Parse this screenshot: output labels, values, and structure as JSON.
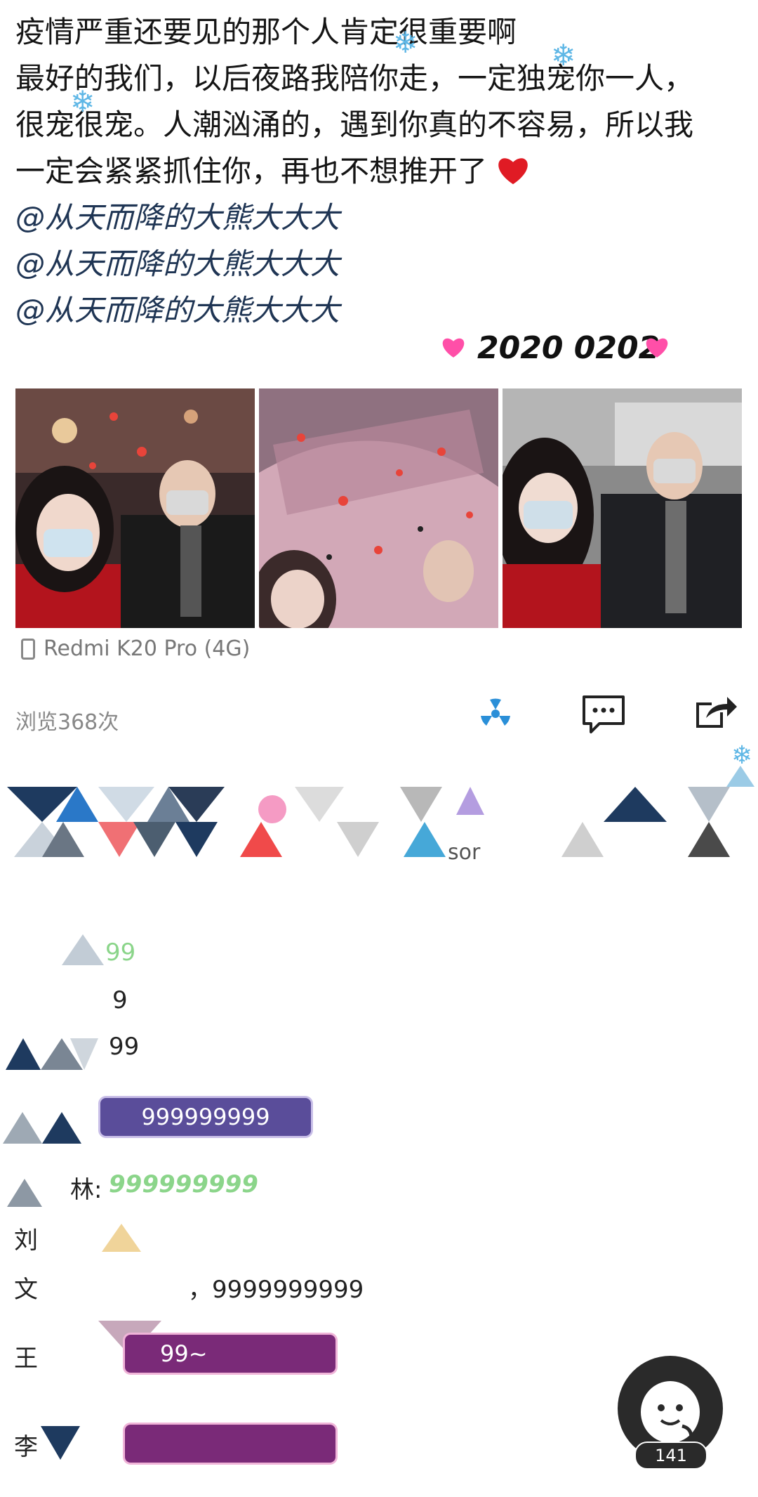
{
  "post": {
    "lines": [
      "疫情严重还要见的那个人肯定很重要啊",
      "最好的我们，以后夜路我陪你走，一定独宠你一人，",
      "很宠很宠。人潮汹涌的，遇到你真的不容易，所以我",
      "一定会紧紧抓住你，再也不想推开了"
    ],
    "mentions": [
      "@从天而降的大熊大大大",
      "@从天而降的大熊大大大",
      "@从天而降的大熊大大大"
    ],
    "date": "2020 0202"
  },
  "device": {
    "label": "Redmi K20 Pro (4G)",
    "icon": "phone-icon"
  },
  "stats": {
    "views": "浏览368次"
  },
  "actions": [
    {
      "name": "radiation-icon",
      "color": "#2a8fd8"
    },
    {
      "name": "comment-icon",
      "color": "#222222"
    },
    {
      "name": "share-icon",
      "color": "#222222"
    }
  ],
  "likers_row": {
    "partial_text": "sor"
  },
  "comments": {
    "c1": "99",
    "c2": "9",
    "c3": "99",
    "c4": "999999999",
    "c5_name": "林:",
    "c5_text": "999999999",
    "c6_name": "刘",
    "c7_name": "文",
    "c7_text": "，9999999999",
    "c8_name": "王",
    "c8_text": "99~",
    "c9_name": "李"
  },
  "float": {
    "count": "141"
  },
  "colors": {
    "mention": "#1f3554",
    "badge_purple": "#5a4d9a",
    "badge_magenta": "#7a2a78",
    "green_text": "#8bd58a"
  }
}
